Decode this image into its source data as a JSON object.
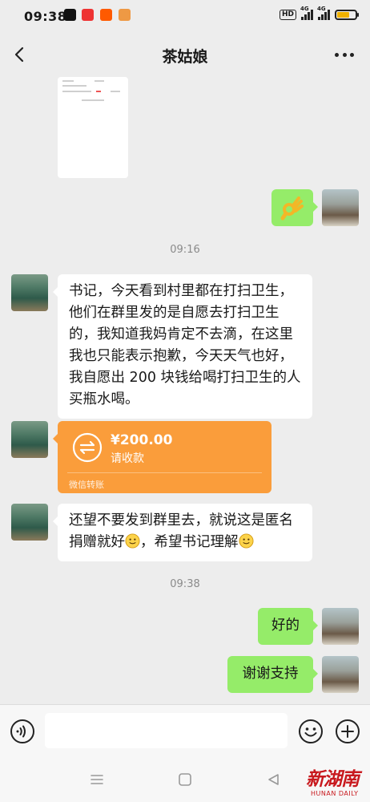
{
  "status_bar": {
    "time": "09:38",
    "hd": "HD",
    "network_1": "4G",
    "network_2": "4G"
  },
  "header": {
    "title": "茶姑娘"
  },
  "messages": {
    "time_1": "09:16",
    "time_2": "09:38",
    "msg_1": "书记，今天看到村里都在打扫卫生，他们在群里发的是自愿去打扫卫生的，我知道我妈肯定不去滴，在这里我也只能表示抱歉，今天天气也好，我自愿出 200 块钱给喝打扫卫生的人买瓶水喝。",
    "transfer": {
      "amount": "¥200.00",
      "status": "请收款",
      "footer": "微信转账"
    },
    "msg_3_part1": "还望不要发到群里去，就说这是匿名捐赠就好",
    "msg_3_part2": "，希望书记理解",
    "reply_1": "好的",
    "reply_2": "谢谢支持"
  },
  "input": {
    "placeholder": ""
  },
  "watermark": {
    "logo": "新湖南",
    "sub": "HUNAN DAILY"
  },
  "colors": {
    "background": "#ededed",
    "own_bubble": "#95ec69",
    "transfer": "#fa9d3b"
  }
}
